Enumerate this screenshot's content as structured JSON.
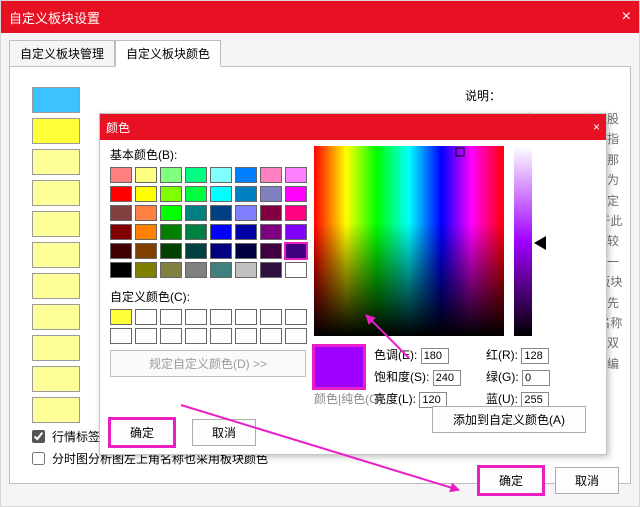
{
  "outer": {
    "title": "自定义板块设置",
    "tabs": {
      "manage": "自定义板块管理",
      "color": "自定义板块颜色"
    },
    "desc_label": "说明：",
    "desc_text": "当需要显示的个股同时隶属于此处指定的多个板块，那么给你显示颜色为顶部最前面的指定颜色。\n\n如果位于此处指定的列表中较前面（上面）的一个。\n\n上下移动板块可以修改板块优先级。\n\n勾选板块名称可以选择板块，双击板块名称可以编辑。",
    "checkbox1": "行情标签和板",
    "checkbox2": "分时图分析图左上角名称也采用板块颜色",
    "ok": "确定",
    "cancel": "取消",
    "left_swatch_colors": [
      "#3cc3ff",
      "#ffff3a",
      "#ffff9a",
      "#ffff9a",
      "#ffff9a",
      "#ffff9a",
      "#ffff9a",
      "#ffff9a",
      "#ffff9a",
      "#ffff9a",
      "#ffff9a"
    ]
  },
  "color": {
    "title": "颜色",
    "basic_label": "基本颜色(B):",
    "custom_label": "自定义颜色(C):",
    "define_btn": "规定自定义颜色(D) >>",
    "ok": "确定",
    "cancel": "取消",
    "add_btn": "添加到自定义颜色(A)",
    "solid_label": "颜色|纯色(O)",
    "hue_label": "色调(E):",
    "sat_label": "饱和度(S):",
    "lum_label": "亮度(L):",
    "r_label": "红(R):",
    "g_label": "绿(G):",
    "b_label": "蓝(U):",
    "hue": "180",
    "sat": "240",
    "lum": "120",
    "r": "128",
    "g": "0",
    "b": "255",
    "preview_hex": "#a000ff",
    "basic_colors": [
      "#ff8080",
      "#ffff80",
      "#80ff80",
      "#00ff80",
      "#80ffff",
      "#0080ff",
      "#ff80c0",
      "#ff80ff",
      "#ff0000",
      "#ffff00",
      "#80ff00",
      "#00ff40",
      "#00ffff",
      "#0080c0",
      "#8080c0",
      "#ff00ff",
      "#804040",
      "#ff8040",
      "#00ff00",
      "#008080",
      "#004080",
      "#8080ff",
      "#800040",
      "#ff0080",
      "#800000",
      "#ff8000",
      "#008000",
      "#008040",
      "#0000ff",
      "#0000a0",
      "#800080",
      "#8000ff",
      "#400000",
      "#804000",
      "#004000",
      "#004040",
      "#000080",
      "#000040",
      "#400040",
      "#400080",
      "#000000",
      "#808000",
      "#808040",
      "#808080",
      "#408080",
      "#c0c0c0",
      "#301040",
      "#ffffff"
    ],
    "custom_colors": [
      "#ffff3a",
      "#ffffff",
      "#ffffff",
      "#ffffff",
      "#ffffff",
      "#ffffff",
      "#ffffff",
      "#ffffff",
      "#ffffff",
      "#ffffff",
      "#ffffff",
      "#ffffff",
      "#ffffff",
      "#ffffff",
      "#ffffff",
      "#ffffff"
    ],
    "selected_basic_index": 39
  }
}
